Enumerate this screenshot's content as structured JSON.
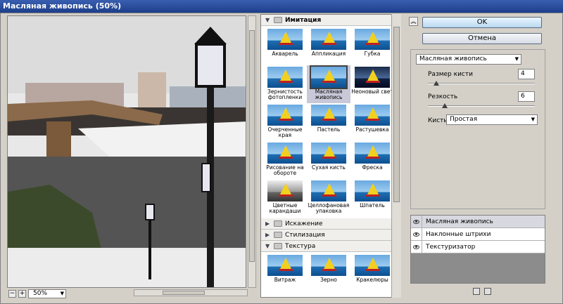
{
  "window": {
    "title": "Масляная живопись (50%)"
  },
  "preview": {
    "zoom": "50%",
    "zoom_out": "−",
    "zoom_in": "+"
  },
  "gallery": {
    "open_category": "Имитация",
    "imitation_filters": [
      {
        "label": "Акварель"
      },
      {
        "label": "Аппликация"
      },
      {
        "label": "Губка"
      },
      {
        "label": "Зернистость фотопленки"
      },
      {
        "label": "Масляная живопись",
        "selected": true
      },
      {
        "label": "Неоновый свет"
      },
      {
        "label": "Очерченные края"
      },
      {
        "label": "Пастель"
      },
      {
        "label": "Растушевка"
      },
      {
        "label": "Рисование на обороте"
      },
      {
        "label": "Сухая кисть"
      },
      {
        "label": "Фреска"
      },
      {
        "label": "Цветные карандаши"
      },
      {
        "label": "Целлофановая упаковка"
      },
      {
        "label": "Шпатель"
      }
    ],
    "collapsed_categories": [
      "Искажение",
      "Стилизация"
    ],
    "texture_category": "Текстура",
    "texture_filters": [
      {
        "label": "Витраж"
      },
      {
        "label": "Зерно"
      },
      {
        "label": "Кракелюры"
      }
    ]
  },
  "buttons": {
    "ok": "OK",
    "cancel": "Отмена"
  },
  "settings": {
    "filter_select": "Масляная живопись",
    "brush_size_label": "Размер кисти",
    "brush_size_value": "4",
    "brush_size_fraction": 0.08,
    "sharpness_label": "Резкость",
    "sharpness_value": "6",
    "sharpness_fraction": 0.16,
    "brush_label": "Кисть:",
    "brush_value": "Простая"
  },
  "layers": [
    {
      "name": "Масляная живопись",
      "active": true
    },
    {
      "name": "Наклонные штрихи"
    },
    {
      "name": "Текстуризатор"
    }
  ],
  "icons": {
    "collapse": "double-chevron-up-icon",
    "eye": "eye-icon",
    "new_layer": "new-layer-icon",
    "delete": "trash-icon"
  }
}
